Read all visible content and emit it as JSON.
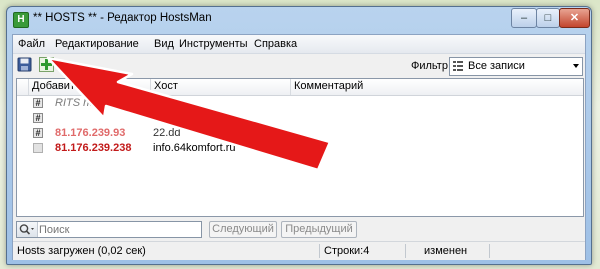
{
  "window": {
    "title": "** HOSTS ** - Редактор HostsMan",
    "app_icon_glyph": "H",
    "min_glyph": "–",
    "max_glyph": "□",
    "close_glyph": "✕"
  },
  "menu": [
    "Файл",
    "Редактирование",
    "Вид",
    "Инструменты",
    "Справка"
  ],
  "toolbar": {
    "filter_label": "Фильтр:",
    "filter_value": "Все записи"
  },
  "grid": {
    "columns": [
      "Добавить",
      "Хост",
      "Комментарий"
    ],
    "rows": [
      {
        "marker": "#",
        "ip": "RITS host",
        "host": "",
        "comment": ""
      },
      {
        "marker": "#",
        "ip": "",
        "host": "",
        "comment": ""
      },
      {
        "marker": "#",
        "ip": "81.176.239.93",
        "host": "22.dd",
        "comment": ""
      },
      {
        "marker": "",
        "ip": "81.176.239.238",
        "host": "info.64komfort.ru",
        "comment": ""
      }
    ]
  },
  "search": {
    "placeholder": "Поиск",
    "next_label": "Следующий",
    "prev_label": "Предыдущий"
  },
  "status": {
    "loaded": "Hosts загружен (0,02 сек)",
    "lines": "Строки:4",
    "state": "изменен"
  },
  "colors": {
    "accent_red": "#d92020",
    "ip_faded": "#e06a6a",
    "ip_active": "#c21a1a",
    "comment_gray": "#7a7a7a"
  },
  "icons": [
    "save-icon",
    "add-icon",
    "remove-icon",
    "filter-icon",
    "search-icon",
    "dropdown-arrow-icon"
  ]
}
